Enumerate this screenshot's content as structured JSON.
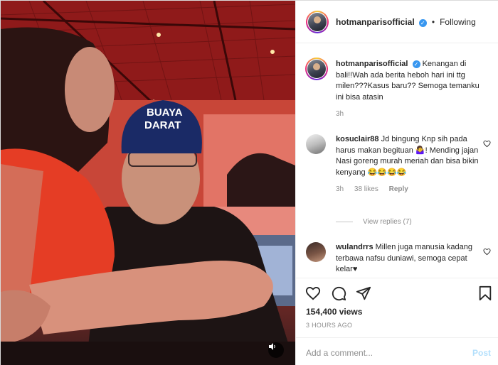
{
  "post": {
    "author": "hotmanparisofficial",
    "follow_status": "Following",
    "dot": "•",
    "cap_line1": "BUAYA",
    "cap_line2": "DARAT"
  },
  "caption": {
    "user": "hotmanparisofficial",
    "text": "Kenangan di bali!!Wah ada berita heboh hari ini ttg milen???Kasus baru?? Semoga temanku ini bisa atasin",
    "time": "3h"
  },
  "comments": [
    {
      "user": "kosuclair88",
      "text": "Jd bingung Knp sih pada harus makan begituan 🤷‍♀️! Mending jajan Nasi goreng murah meriah dan bisa bikin kenyang 😂😂😂😂",
      "time": "3h",
      "likes": "38 likes",
      "reply": "Reply",
      "view_replies": "View replies (7)"
    },
    {
      "user": "wulandrrs",
      "text": "Millen juga manusia kadang terbawa nafsu duniawi, semoga cepat kelar♥",
      "time": "",
      "likes": "",
      "reply": ""
    }
  ],
  "stats": {
    "views": "154,400 views",
    "time_ago": "3 HOURS AGO"
  },
  "comment_box": {
    "placeholder": "Add a comment...",
    "post_label": "Post"
  },
  "icons": [
    "heart-icon",
    "comment-icon",
    "share-icon",
    "bookmark-icon",
    "verified-badge-icon",
    "volume-icon"
  ],
  "colors": {
    "verified": "#3897f0",
    "post_disabled": "#b2dffc",
    "muted_text": "#8e8e8e"
  }
}
